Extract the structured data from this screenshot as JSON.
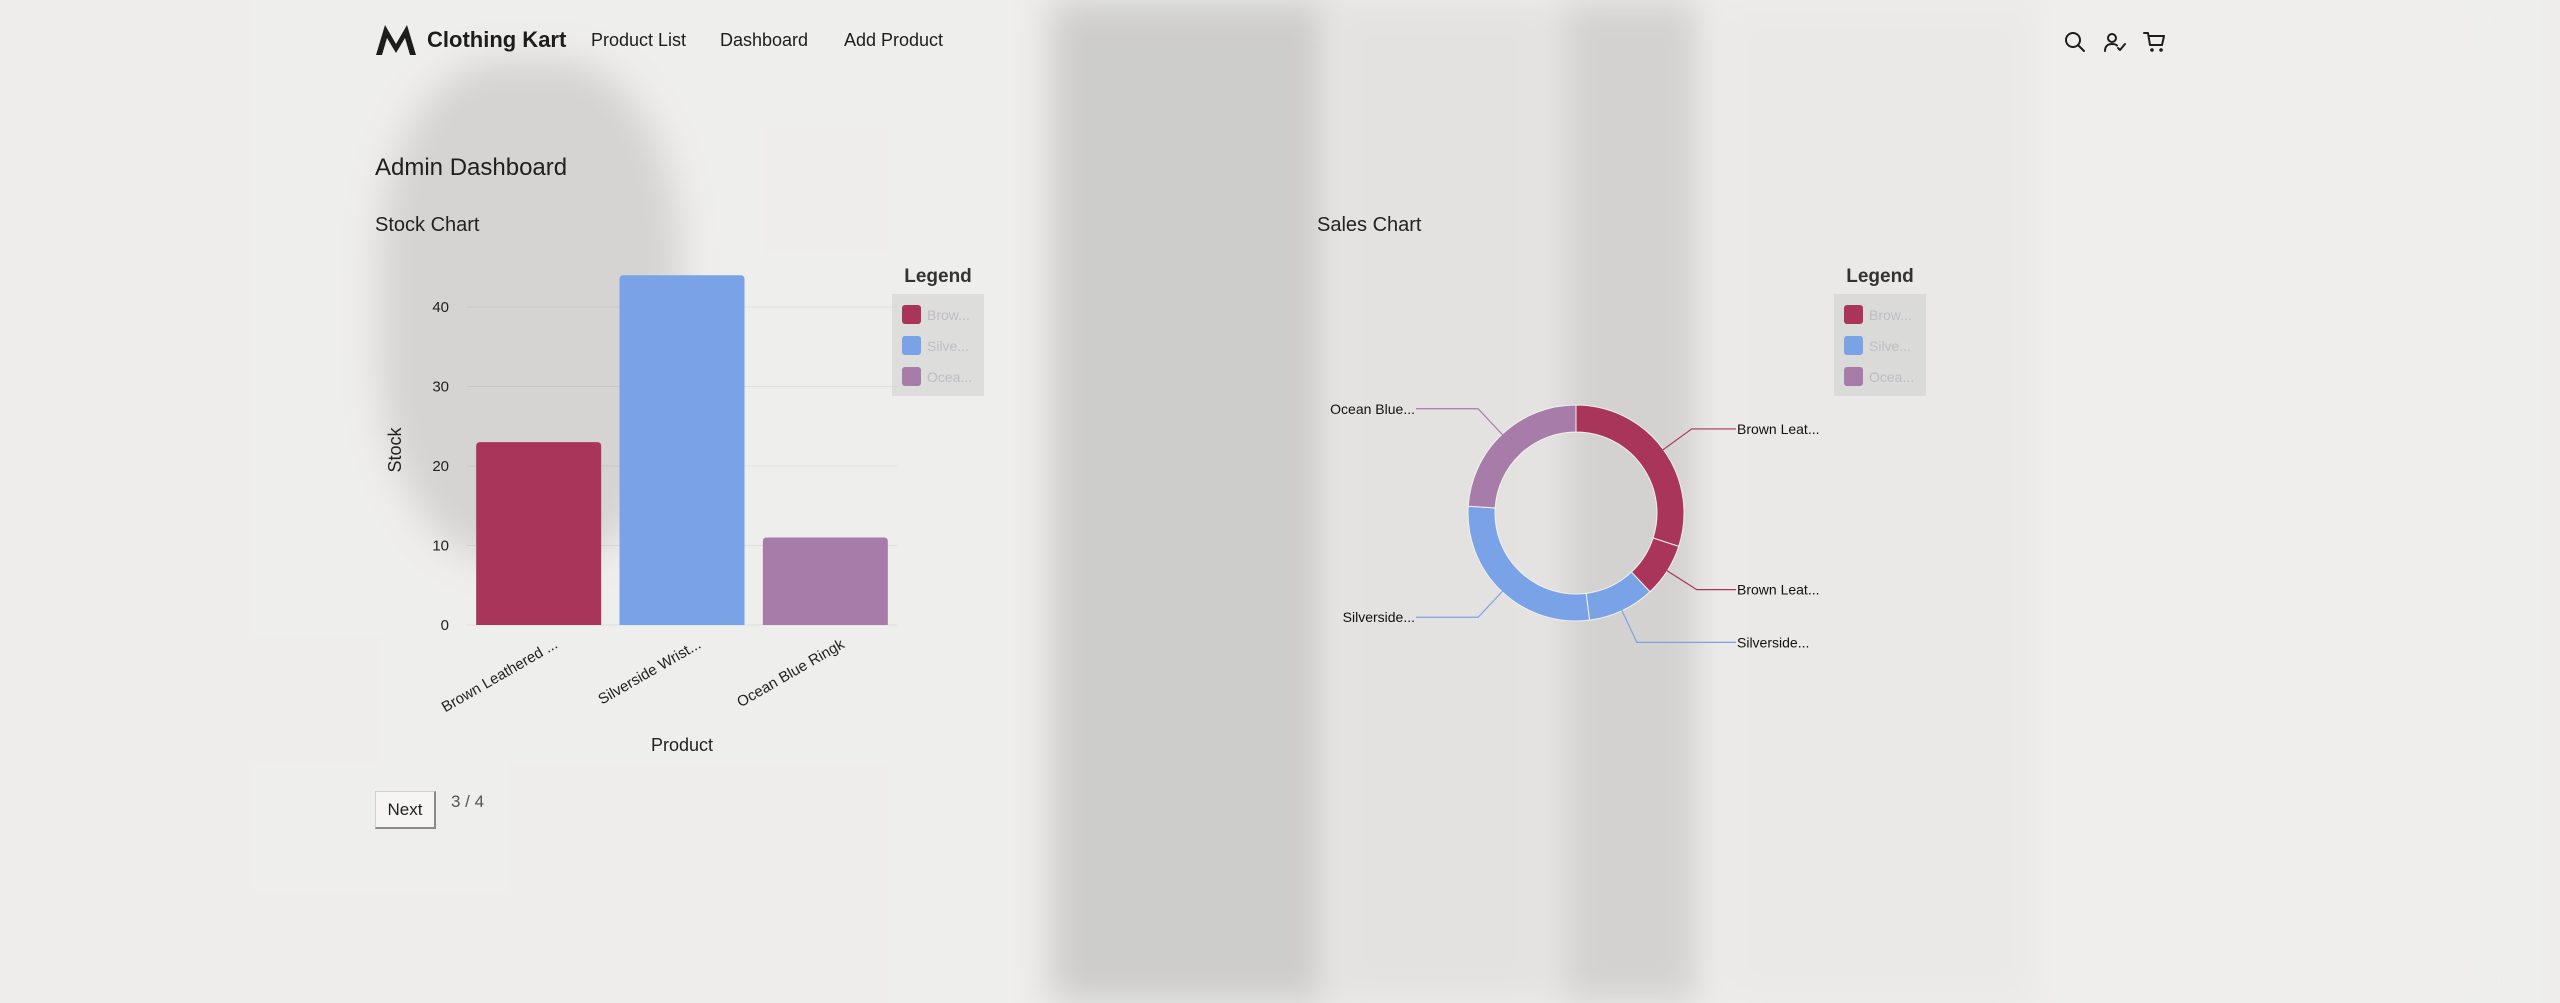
{
  "header": {
    "brand": "Clothing Kart",
    "nav": [
      "Product List",
      "Dashboard",
      "Add Product"
    ],
    "icons": [
      "search-icon",
      "user-check-icon",
      "cart-icon"
    ]
  },
  "page": {
    "title": "Admin Dashboard",
    "stock_title": "Stock Chart",
    "sales_title": "Sales Chart"
  },
  "legend": {
    "title": "Legend",
    "items": [
      "Brow...",
      "Silve...",
      "Ocea..."
    ]
  },
  "pagination": {
    "next_label": "Next",
    "indicator": "3 / 4"
  },
  "colors": {
    "brown": "#a9365a",
    "silver": "#79a3e6",
    "ocean": "#a77ca9"
  },
  "chart_data": [
    {
      "type": "bar",
      "categories": [
        "Brown Leathered ...",
        "Silverside Wrist...",
        "Ocean Blue Ringk"
      ],
      "values": [
        23,
        44,
        11
      ],
      "xlabel": "Product",
      "ylabel": "Stock",
      "yticks": [
        0,
        10,
        20,
        30,
        40
      ],
      "ylim": [
        0,
        44
      ],
      "legend": [
        "Brow...",
        "Silve...",
        "Ocea..."
      ],
      "legend_position": "right"
    },
    {
      "type": "pie",
      "variant": "donut",
      "slices": [
        {
          "label": "Brown Leat...",
          "color": "#a9365a",
          "value": 0.3
        },
        {
          "label": "Brown Leat...",
          "color": "#a9365a",
          "value": 0.08
        },
        {
          "label": "Silverside...",
          "color": "#79a3e6",
          "value": 0.1
        },
        {
          "label": "Silverside...",
          "color": "#79a3e6",
          "value": 0.28
        },
        {
          "label": "Ocean Blue...",
          "color": "#a77ca9",
          "value": 0.24
        }
      ],
      "legend": [
        "Brow...",
        "Silve...",
        "Ocea..."
      ],
      "legend_position": "right"
    }
  ]
}
